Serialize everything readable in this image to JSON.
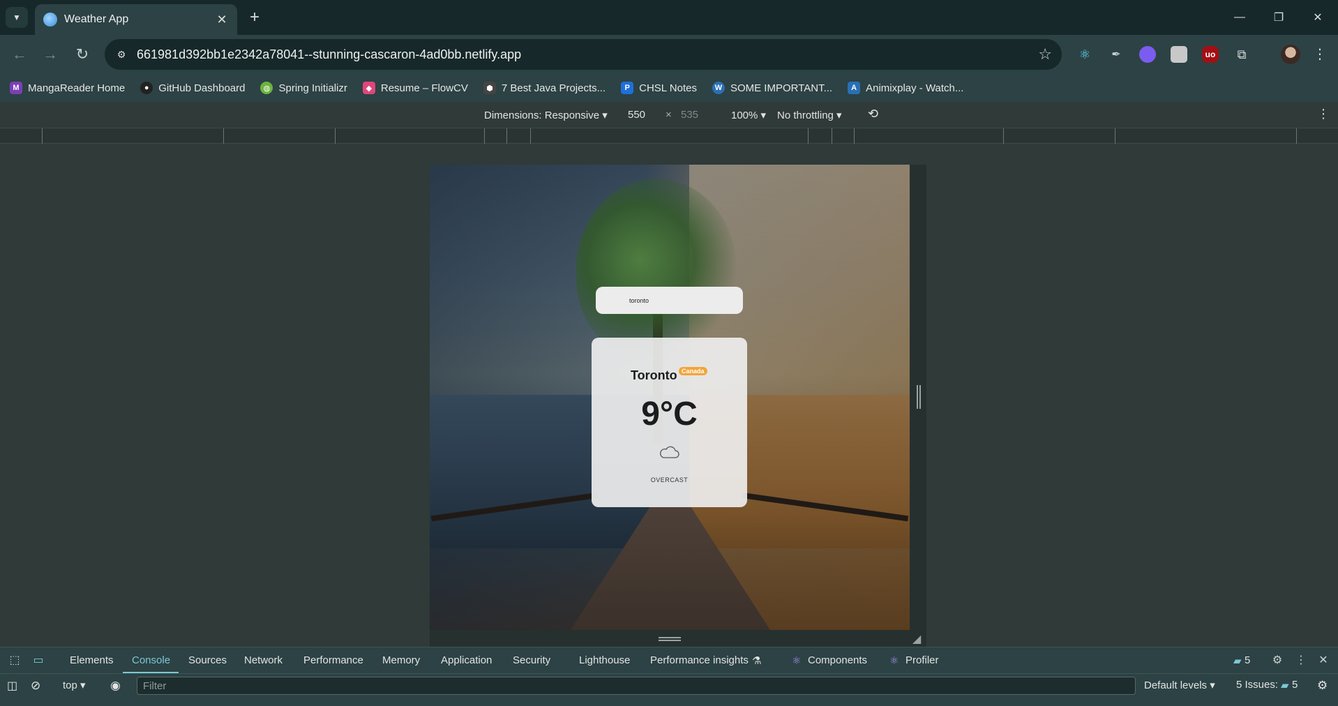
{
  "browser": {
    "tab_title": "Weather App",
    "tab_close": "✕",
    "new_tab": "+",
    "url": "661981d392bb1e2342a78041--stunning-cascaron-4ad0bb.netlify.app",
    "window_controls": {
      "minimize": "—",
      "restore": "❐",
      "close": "✕"
    },
    "nav": {
      "back": "←",
      "forward": "→",
      "reload": "↻"
    }
  },
  "bookmarks": [
    {
      "label": "MangaReader Home",
      "icon_color": "#7b3fb5",
      "glyph": "M"
    },
    {
      "label": "GitHub Dashboard",
      "icon_color": "#222222",
      "glyph": "●"
    },
    {
      "label": "Spring Initializr",
      "icon_color": "#6db33f",
      "glyph": "◍"
    },
    {
      "label": "Resume – FlowCV",
      "icon_color": "#e0467a",
      "glyph": "◆"
    },
    {
      "label": "7 Best Java Projects...",
      "icon_color": "#444444",
      "glyph": "⬢"
    },
    {
      "label": "CHSL Notes",
      "icon_color": "#1e6fd9",
      "glyph": "P"
    },
    {
      "label": "SOME IMPORTANT...",
      "icon_color": "#2a6fb5",
      "glyph": "W"
    },
    {
      "label": "Animixplay - Watch...",
      "icon_color": "#2a6fb5",
      "glyph": "A"
    }
  ],
  "device_toolbar": {
    "dimensions_label": "Dimensions: Responsive ▾",
    "width": "550",
    "times": "×",
    "height": "535",
    "zoom": "100% ▾",
    "throttling": "No throttling ▾"
  },
  "weather": {
    "search_value": "toronto",
    "city": "Toronto",
    "country": "Canada",
    "temperature": "9°C",
    "condition": "OVERCAST"
  },
  "devtools": {
    "tabs": [
      "Elements",
      "Console",
      "Sources",
      "Network",
      "Performance",
      "Memory",
      "Application",
      "Security",
      "Lighthouse",
      "Performance insights",
      "Components",
      "Profiler"
    ],
    "active_tab": "Console",
    "message_count": "5",
    "context": "top ▾",
    "filter_placeholder": "Filter",
    "levels": "Default levels ▾",
    "issues": "5 Issues:",
    "issues_count": "5"
  }
}
